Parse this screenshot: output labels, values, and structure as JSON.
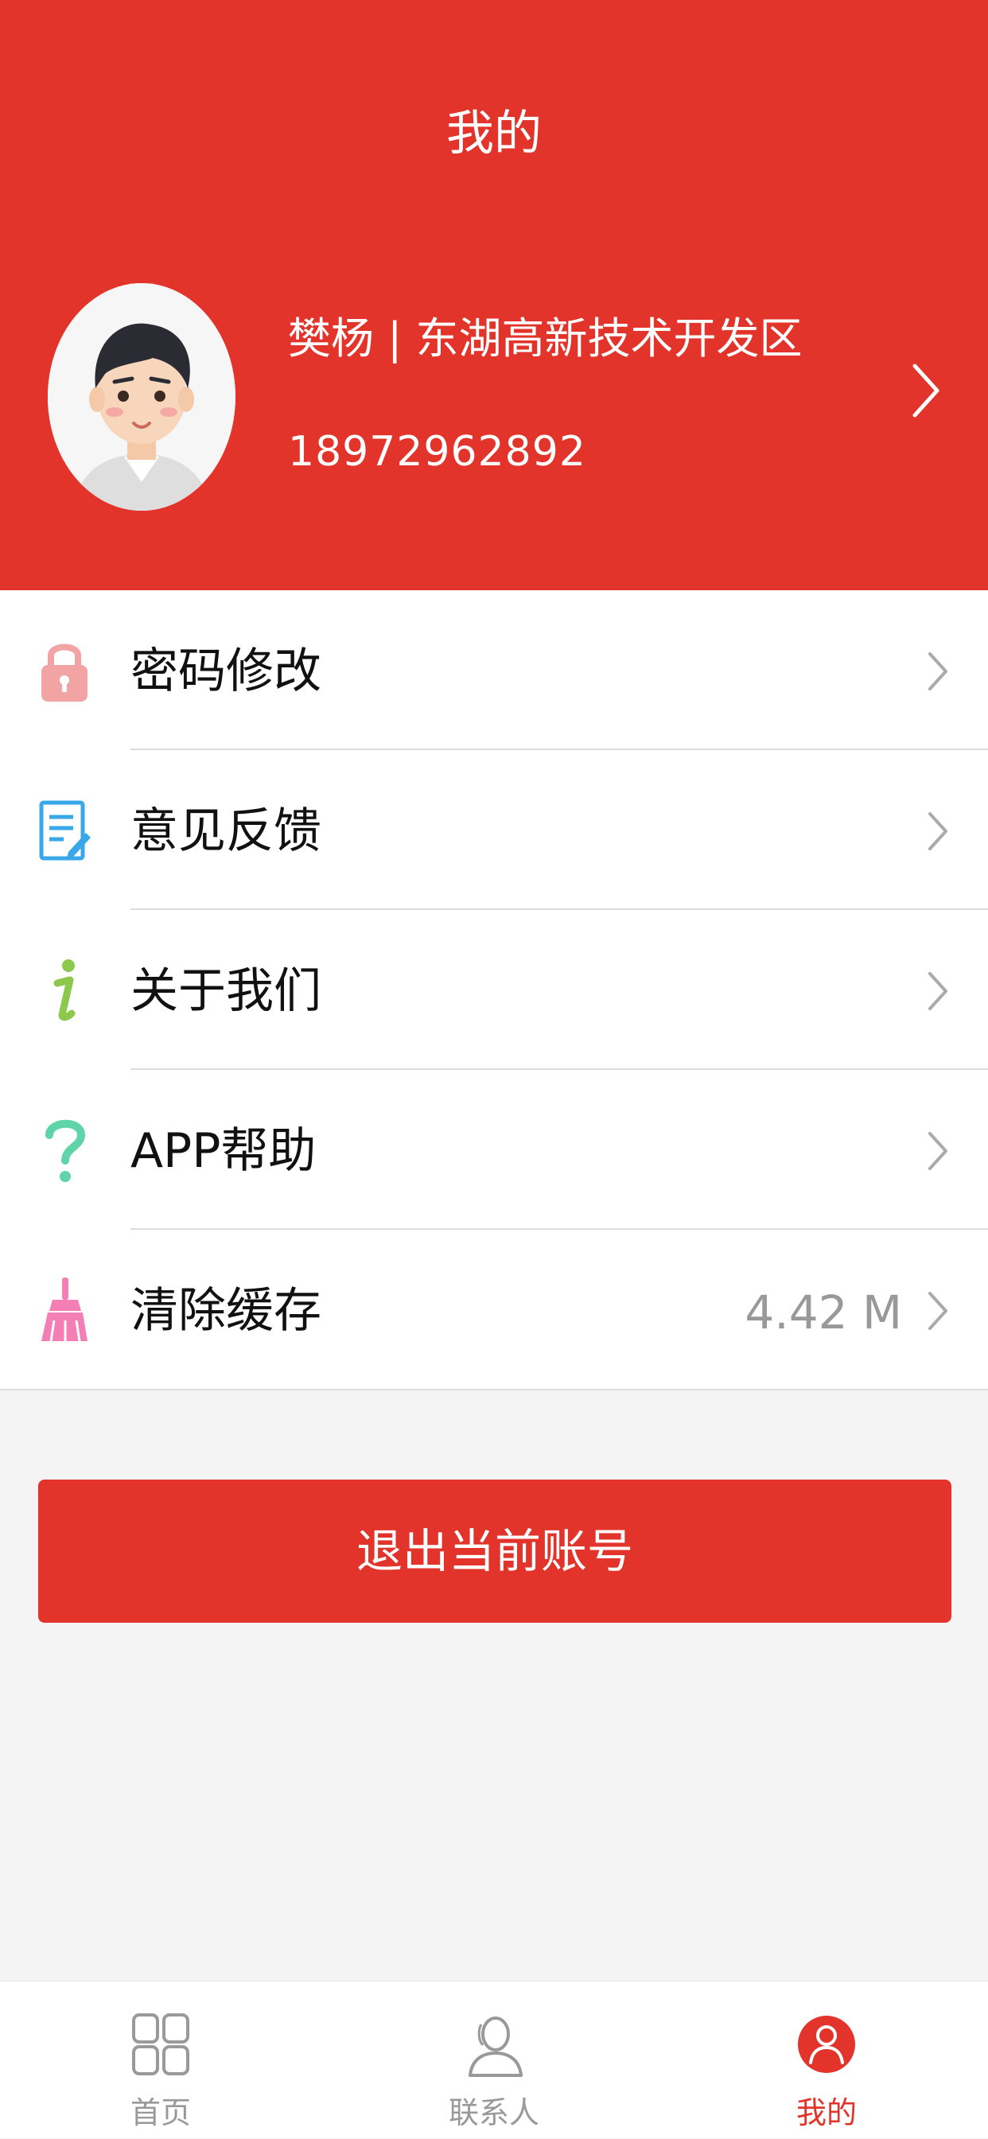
{
  "header": {
    "title": "我的",
    "background_color": "#e2342a"
  },
  "profile": {
    "name_line": "樊杨 | 东湖高新技术开发区",
    "phone": "18972962892",
    "avatar_icon": "user-avatar",
    "chevron_icon": "chevron-right-icon"
  },
  "menu": {
    "items": [
      {
        "label": "密码修改",
        "icon": "lock-icon",
        "icon_color": "#f2a4a4"
      },
      {
        "label": "意见反馈",
        "icon": "feedback-edit-icon",
        "icon_color": "#3aa7e8"
      },
      {
        "label": "关于我们",
        "icon": "info-icon",
        "icon_color": "#8cc84b"
      },
      {
        "label": "APP帮助",
        "icon": "question-icon",
        "icon_color": "#5fd4a9"
      },
      {
        "label": "清除缓存",
        "icon": "broom-icon",
        "icon_color": "#f37fb4",
        "value": "4.42 M"
      }
    ]
  },
  "logout": {
    "label": "退出当前账号"
  },
  "tabbar": {
    "tabs": [
      {
        "label": "首页",
        "icon": "grid-home-icon",
        "active": false
      },
      {
        "label": "联系人",
        "icon": "contacts-icon",
        "active": false
      },
      {
        "label": "我的",
        "icon": "profile-icon",
        "active": true
      }
    ],
    "active_color": "#e2342a",
    "inactive_color": "#999999"
  }
}
